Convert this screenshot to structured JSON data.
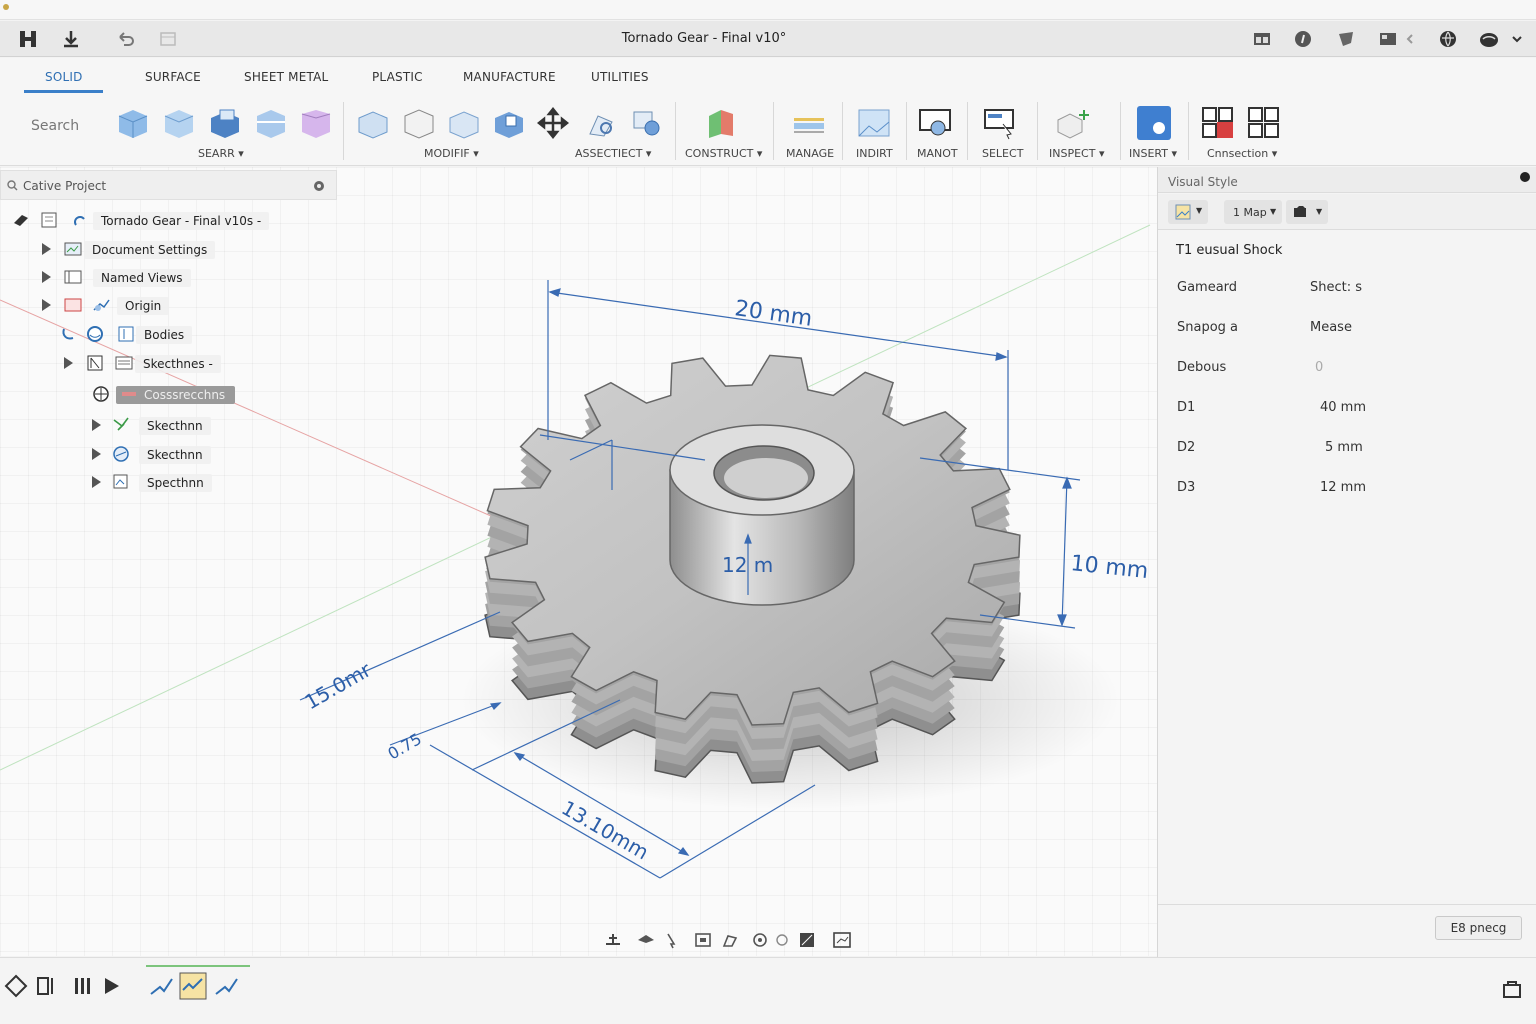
{
  "window": {
    "title": "Tornado Gear - Final v10°"
  },
  "tabs": [
    {
      "label": "SOLID",
      "active": true
    },
    {
      "label": "SURFACE"
    },
    {
      "label": "SHEET METAL"
    },
    {
      "label": "PLASTIC"
    },
    {
      "label": "MANUFACTURE"
    },
    {
      "label": "UTILITIES"
    }
  ],
  "ribbon": {
    "search_placeholder": "Search",
    "groups": [
      {
        "label": "SEARR"
      },
      {
        "label": "MODIFIF"
      },
      {
        "label": "ASSECTIECT"
      },
      {
        "label": "CONSTRUCT"
      },
      {
        "label": "MANAGE"
      },
      {
        "label": "INDIRT"
      },
      {
        "label": "MANOT"
      },
      {
        "label": "SELECT"
      },
      {
        "label": "INSPECT"
      },
      {
        "label": "INSERT"
      },
      {
        "label": "Cnnsection"
      }
    ]
  },
  "browser": {
    "header": "Cative Project",
    "root": "Tornado Gear - Final v10s -",
    "items": [
      {
        "label": "Document Settings"
      },
      {
        "label": "Named Views"
      },
      {
        "label": "Origin"
      },
      {
        "label": "Bodies"
      },
      {
        "label": "Skecthnes -"
      },
      {
        "label": "Cosssrecchns",
        "selected": true
      },
      {
        "label": "Skecthnn"
      },
      {
        "label": "Skecthnn"
      },
      {
        "label": "Specthnn"
      }
    ]
  },
  "viewport": {
    "dimensions": {
      "top": "20 mm",
      "bore": "12 m",
      "height": "10 mm",
      "diag_left": "15.0mr",
      "small": "0.75",
      "bottom": "13.10mm"
    }
  },
  "visual_style": {
    "header": "Visual Style",
    "dropdown_2": "1 Map",
    "section_title": "T1 eusual Shock",
    "props": [
      {
        "key": "Gameard",
        "value": "Shect: s"
      },
      {
        "key": "Snapog a",
        "value": "Mease"
      },
      {
        "key": "Debous",
        "value": "0"
      },
      {
        "key": "D1",
        "value": "40 mm"
      },
      {
        "key": "D2",
        "value": "5 mm"
      },
      {
        "key": "D3",
        "value": "12 mm"
      }
    ],
    "footer_button": "E8 pnecg"
  },
  "colors": {
    "accent": "#2f6fb3",
    "dimension": "#2c5ea8"
  }
}
